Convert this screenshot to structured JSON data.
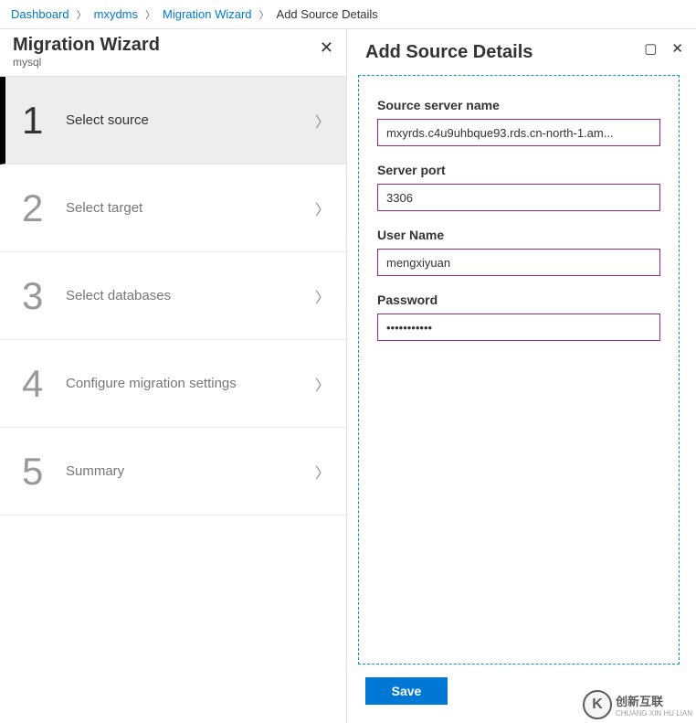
{
  "breadcrumb": {
    "items": [
      {
        "label": "Dashboard",
        "link": true
      },
      {
        "label": "mxydms",
        "link": true
      },
      {
        "label": "Migration Wizard",
        "link": true
      },
      {
        "label": "Add Source Details",
        "link": false
      }
    ]
  },
  "wizard": {
    "title": "Migration Wizard",
    "subtitle": "mysql",
    "steps": [
      {
        "num": "1",
        "label": "Select source",
        "active": true
      },
      {
        "num": "2",
        "label": "Select target",
        "active": false
      },
      {
        "num": "3",
        "label": "Select databases",
        "active": false
      },
      {
        "num": "4",
        "label": "Configure migration settings",
        "active": false
      },
      {
        "num": "5",
        "label": "Summary",
        "active": false
      }
    ]
  },
  "details": {
    "title": "Add Source Details",
    "fields": {
      "server_name_label": "Source server name",
      "server_name_value": "mxyrds.c4u9uhbque93.rds.cn-north-1.am...",
      "port_label": "Server port",
      "port_value": "3306",
      "user_label": "User Name",
      "user_value": "mengxiyuan",
      "password_label": "Password",
      "password_value": "•••••••••••"
    },
    "save_label": "Save"
  },
  "watermark": {
    "brand": "创新互联",
    "sub": "CHUANG XIN HU LIAN"
  }
}
